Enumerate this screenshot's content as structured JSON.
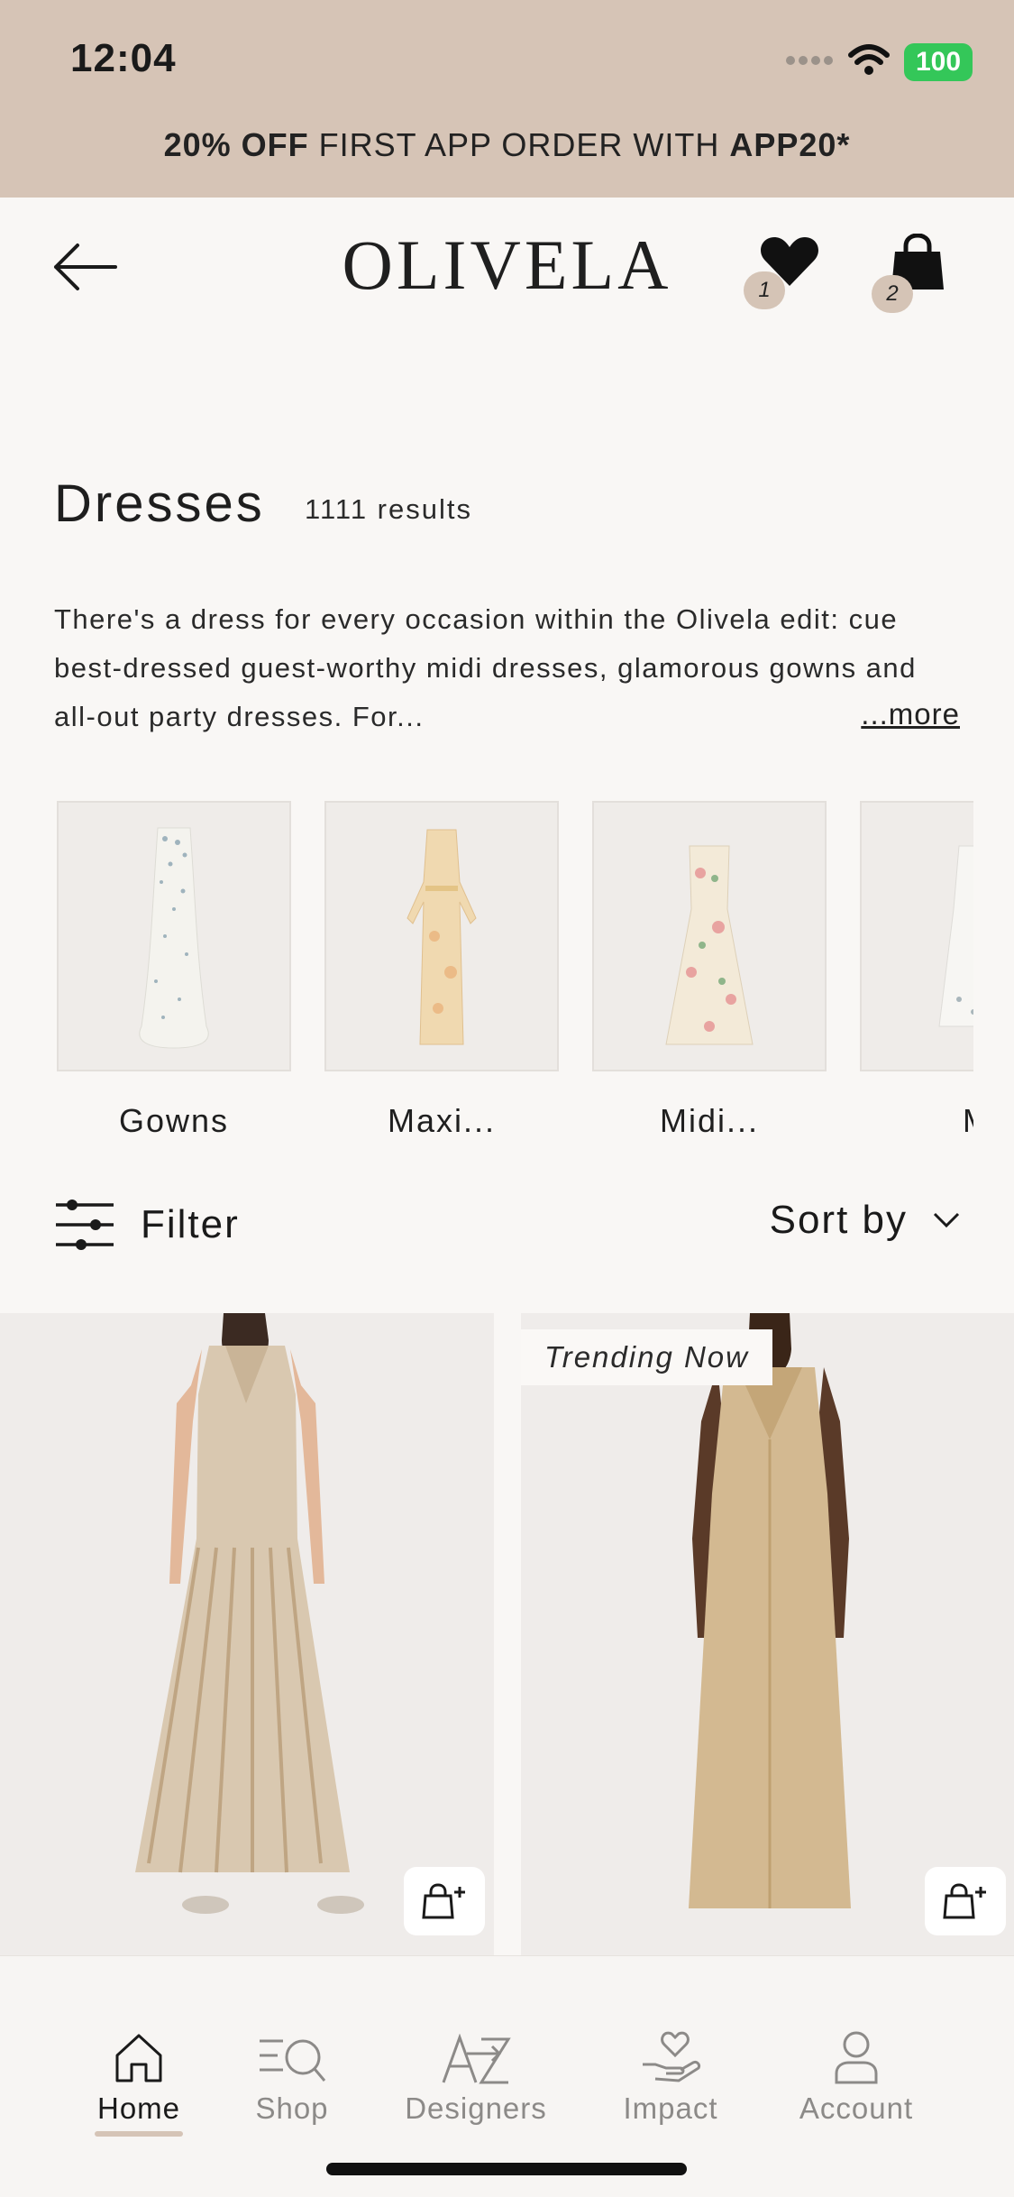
{
  "status_bar": {
    "time": "12:04",
    "battery": "100"
  },
  "promo": {
    "bold_1": "20% OFF",
    "text": " FIRST APP ORDER WITH ",
    "bold_2": "APP20*"
  },
  "header": {
    "logo": "OLIVELA",
    "wishlist_count": "1",
    "bag_count": "2"
  },
  "category": {
    "title": "Dresses",
    "count": "1111 results",
    "description": "There's a dress for every occasion within the Olivela edit: cue best-dressed guest-worthy midi dresses, glamorous gowns and all-out party dresses. For...",
    "more_label": "...more"
  },
  "subcategories": [
    {
      "label": "Gowns"
    },
    {
      "label": "Maxi..."
    },
    {
      "label": "Midi..."
    },
    {
      "label": "M"
    }
  ],
  "toolbar": {
    "filter_label": "Filter",
    "sort_label": "Sort by"
  },
  "products": [
    {
      "tag": ""
    },
    {
      "tag": "Trending Now"
    }
  ],
  "tabbar": {
    "home": "Home",
    "shop": "Shop",
    "designers": "Designers",
    "impact": "Impact",
    "account": "Account"
  },
  "colors": {
    "accent": "#d5c4b6",
    "battery": "#34c759",
    "background": "#f9f7f5"
  }
}
